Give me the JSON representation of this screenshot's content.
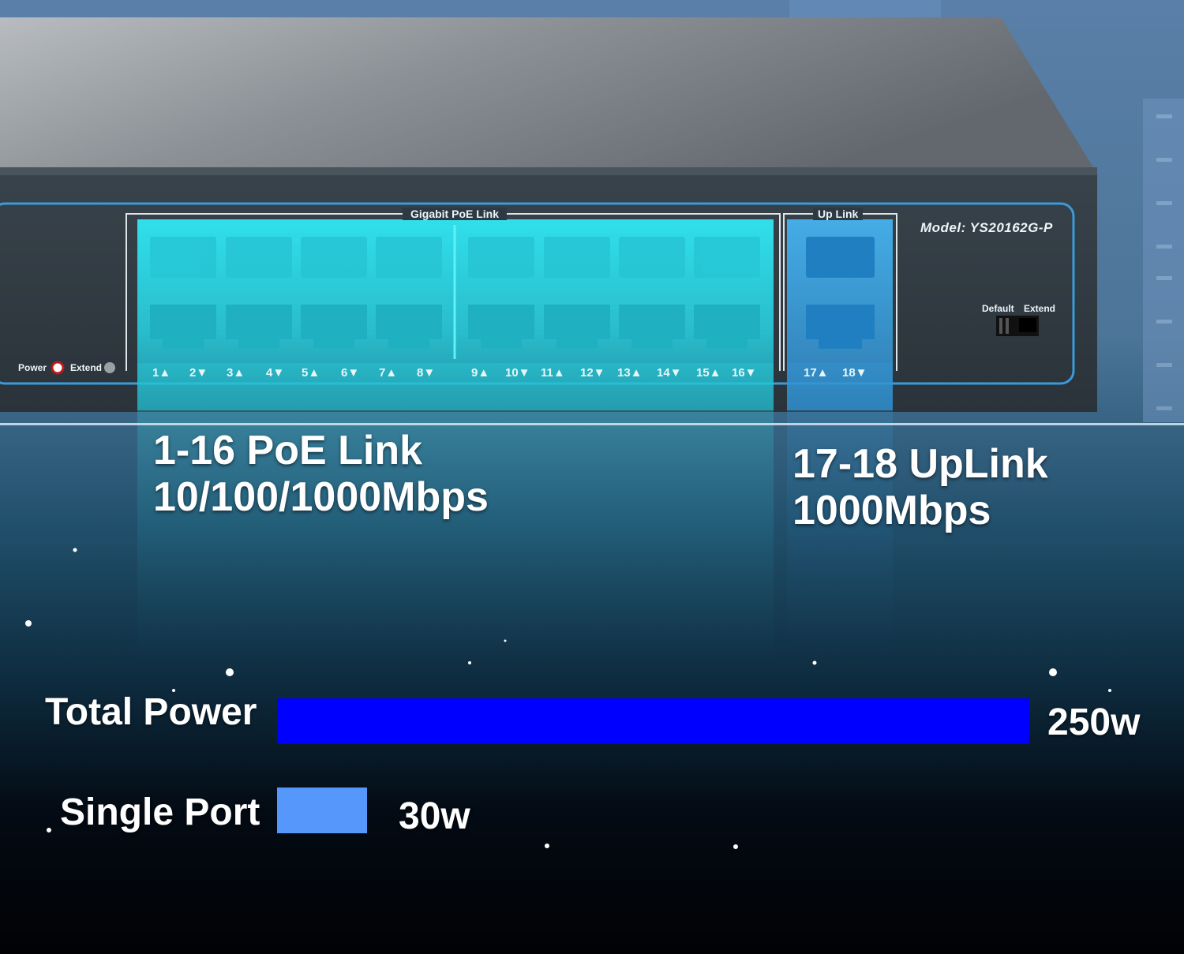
{
  "device": {
    "model": "Model: YS20162G-P",
    "group_poe": "Gigabit PoE Link",
    "group_uplink": "Up Link",
    "switch_default": "Default",
    "switch_extend": "Extend",
    "led_power": "Power",
    "led_extend": "Extend",
    "port_labels": [
      "1▲",
      "2▼",
      "3▲",
      "4▼",
      "5▲",
      "6▼",
      "7▲",
      "8▼",
      "9▲",
      "10▼",
      "11▲",
      "12▼",
      "13▲",
      "14▼",
      "15▲",
      "16▼",
      "17▲",
      "18▼"
    ]
  },
  "callouts": {
    "poe_title": "1-16 PoE Link",
    "poe_speed": "10/100/1000Mbps",
    "uplink_title": "17-18 UpLink",
    "uplink_speed": "1000Mbps"
  },
  "power": {
    "total_label": "Total Power",
    "total_value": "250w",
    "total_watts": 250,
    "single_label": "Single Port",
    "single_value": "30w",
    "single_watts": 30,
    "total_color": "#0000ff",
    "single_color": "#5597fa"
  },
  "colors": {
    "poe_glow": "#2ee6f2",
    "uplink_glow": "#3aa7e6",
    "panel_accent": "#3a9bd8"
  }
}
